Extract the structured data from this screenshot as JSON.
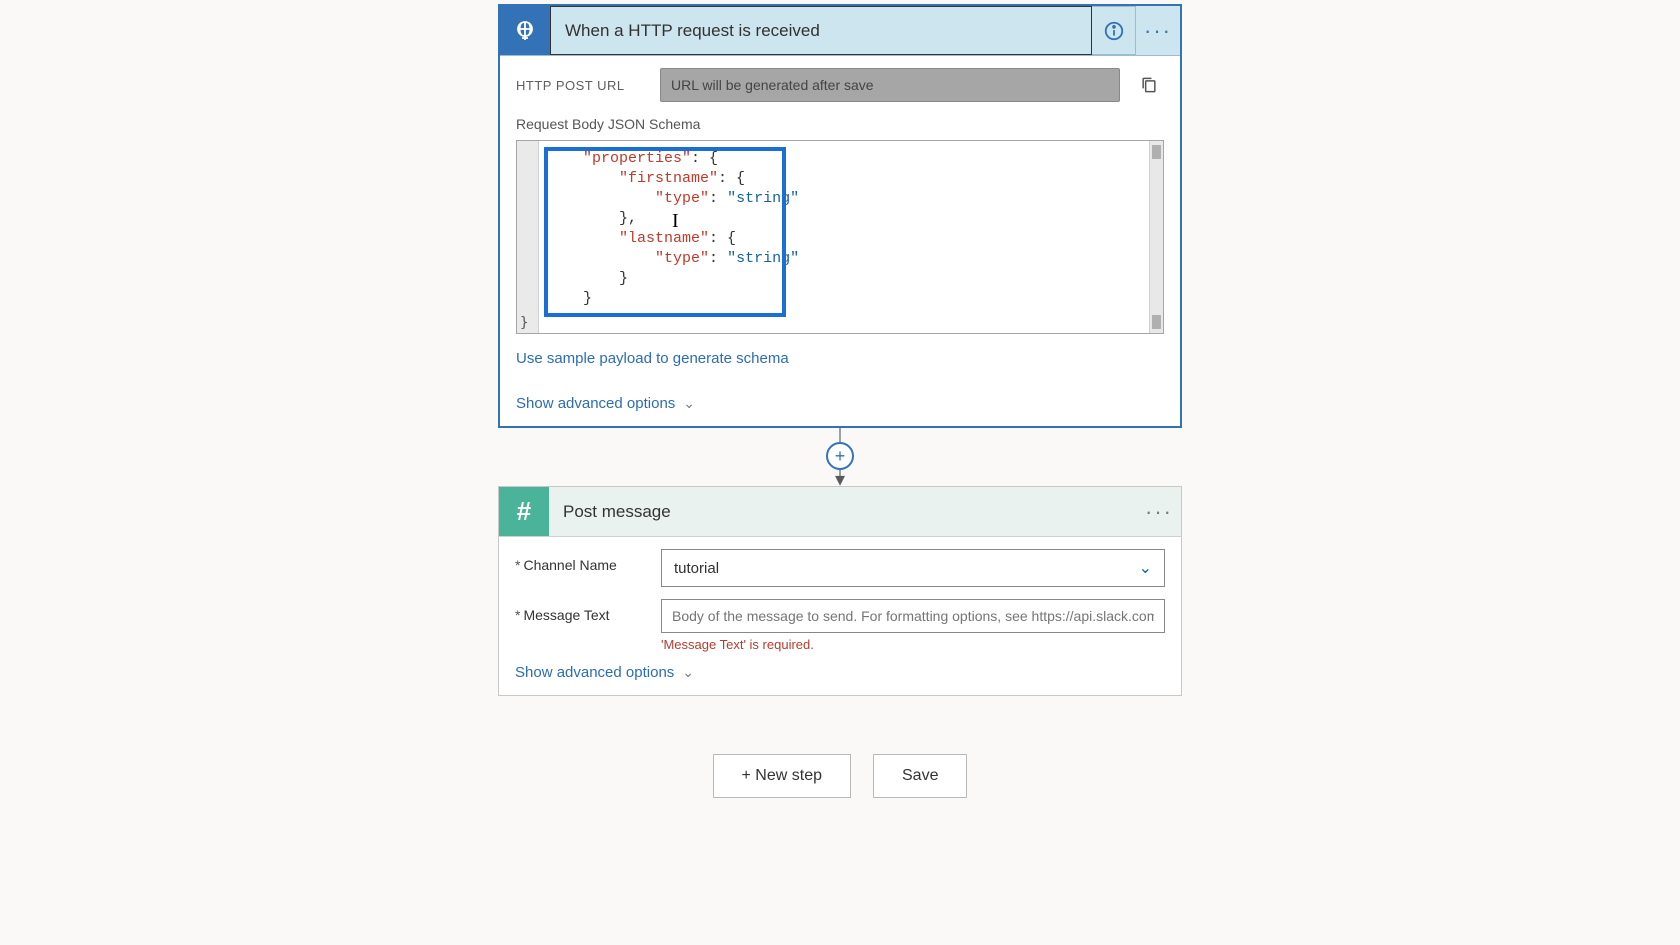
{
  "trigger": {
    "title": "When a HTTP request is received",
    "url_label": "HTTP POST URL",
    "url_placeholder": "URL will be generated after save",
    "schema_label": "Request Body JSON Schema",
    "schema_code": {
      "line1_key": "\"properties\"",
      "line1_rest": ": {",
      "line2_key": "\"firstname\"",
      "line2_rest": ": {",
      "line3_key": "\"type\"",
      "line3_sep": ": ",
      "line3_val": "\"string\"",
      "line4": "},",
      "line5_key": "\"lastname\"",
      "line5_rest": ": {",
      "line6_key": "\"type\"",
      "line6_sep": ": ",
      "line6_val": "\"string\"",
      "line7": "}",
      "line8": "}",
      "tail": "}"
    },
    "sample_link": "Use sample payload to generate schema",
    "advanced": "Show advanced options"
  },
  "slack": {
    "title": "Post message",
    "channel_label": "Channel Name",
    "channel_value": "tutorial",
    "message_label": "Message Text",
    "message_placeholder": "Body of the message to send. For formatting options, see https://api.slack.com/",
    "message_error": "'Message Text' is required.",
    "advanced": "Show advanced options"
  },
  "footer": {
    "new_step": "+ New step",
    "save": "Save"
  }
}
